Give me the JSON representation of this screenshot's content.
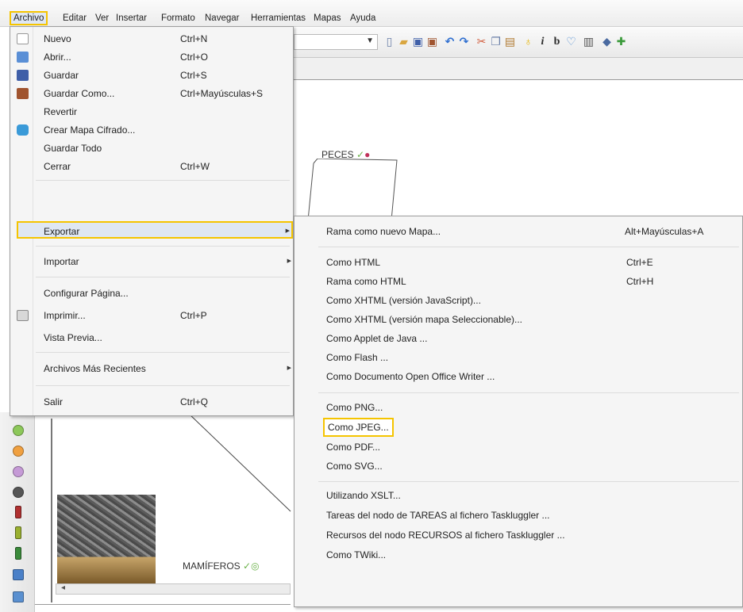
{
  "menubar": {
    "items": [
      "Archivo",
      "Editar",
      "Ver",
      "Insertar",
      "Formato",
      "Navegar",
      "Herramientas",
      "Mapas",
      "Ayuda"
    ]
  },
  "canvas": {
    "node_top": "PECES",
    "node_bottom": "MAMÍFEROS"
  },
  "archivo_menu": {
    "items": [
      {
        "label": "Nuevo",
        "shortcut": "Ctrl+N",
        "icon": "new-document-icon"
      },
      {
        "label": "Abrir...",
        "shortcut": "Ctrl+O",
        "icon": "open-folder-icon"
      },
      {
        "label": "Guardar",
        "shortcut": "Ctrl+S",
        "icon": "save-disk-icon"
      },
      {
        "label": "Guardar Como...",
        "shortcut": "Ctrl+Mayúsculas+S",
        "icon": "save-as-icon"
      },
      {
        "label": "Revertir",
        "shortcut": "",
        "icon": ""
      },
      {
        "label": "Crear Mapa Cifrado...",
        "shortcut": "",
        "icon": "encrypted-map-icon"
      },
      {
        "label": "Guardar Todo",
        "shortcut": "",
        "icon": ""
      },
      {
        "label": "Cerrar",
        "shortcut": "Ctrl+W",
        "icon": ""
      },
      {
        "label": "Exportar",
        "shortcut": "",
        "icon": "",
        "submenu": true
      },
      {
        "label": "Importar",
        "shortcut": "",
        "icon": "",
        "submenu": true
      },
      {
        "label": "Configurar Página...",
        "shortcut": "",
        "icon": ""
      },
      {
        "label": "Imprimir...",
        "shortcut": "Ctrl+P",
        "icon": "printer-icon"
      },
      {
        "label": "Vista Previa...",
        "shortcut": "",
        "icon": ""
      },
      {
        "label": "Archivos Más Recientes",
        "shortcut": "",
        "icon": "",
        "submenu": true
      },
      {
        "label": "Salir",
        "shortcut": "Ctrl+Q",
        "icon": ""
      }
    ]
  },
  "exportar_submenu": {
    "items": [
      {
        "label": "Rama como nuevo Mapa...",
        "shortcut": "Alt+Mayúsculas+A"
      },
      {
        "label": "Como HTML",
        "shortcut": "Ctrl+E"
      },
      {
        "label": "Rama como HTML",
        "shortcut": "Ctrl+H"
      },
      {
        "label": "Como XHTML (versión JavaScript)...",
        "shortcut": ""
      },
      {
        "label": "Como XHTML (versión mapa Seleccionable)...",
        "shortcut": ""
      },
      {
        "label": "Como Applet de Java ...",
        "shortcut": ""
      },
      {
        "label": "Como Flash ...",
        "shortcut": ""
      },
      {
        "label": "Como Documento Open Office Writer ...",
        "shortcut": ""
      },
      {
        "label": "Como PNG...",
        "shortcut": ""
      },
      {
        "label": "Como JPEG...",
        "shortcut": ""
      },
      {
        "label": "Como PDF...",
        "shortcut": ""
      },
      {
        "label": "Como SVG...",
        "shortcut": ""
      },
      {
        "label": "Utilizando XSLT...",
        "shortcut": ""
      },
      {
        "label": "Tareas del nodo de TAREAS al fichero Taskluggler ...",
        "shortcut": ""
      },
      {
        "label": "Recursos del nodo RECURSOS al fichero Taskluggler ...",
        "shortcut": ""
      },
      {
        "label": "Como TWiki...",
        "shortcut": ""
      }
    ]
  },
  "colors": {
    "highlight_border": "#f5c400",
    "menu_bg": "#f5f5f5",
    "selection_bg": "#dfe7f3"
  }
}
